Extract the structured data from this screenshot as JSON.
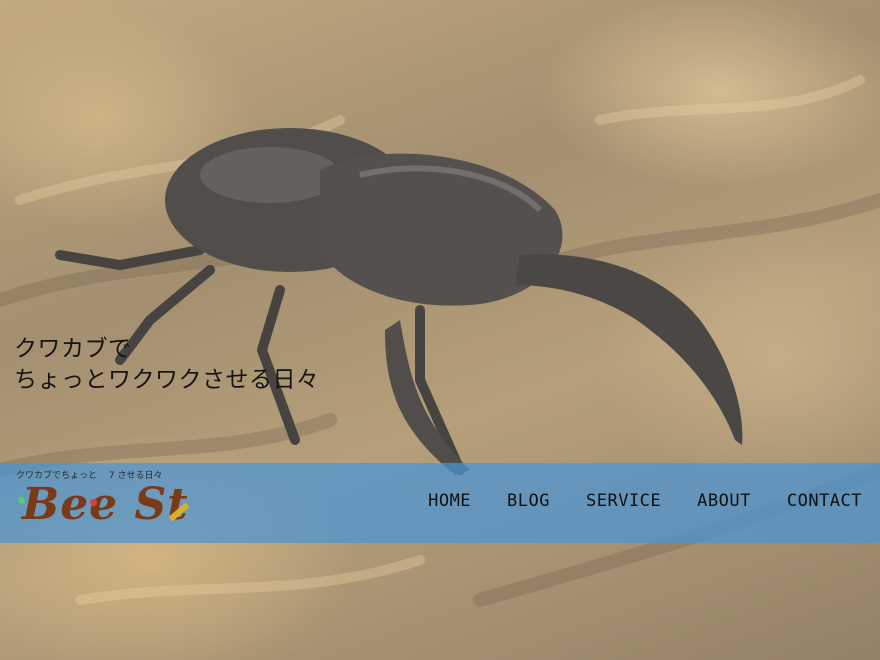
{
  "hero": {
    "image_label": "stag beetle on wood",
    "tagline_line1": "クワカブで",
    "tagline_line2": "ちょっとワクワクさせる日々"
  },
  "logo": {
    "subtitle": "クワカブでちょっと 　7 させる日々",
    "wordmark": "Bee St"
  },
  "nav": {
    "items": [
      "HOME",
      "BLOG",
      "SERVICE",
      "ABOUT",
      "CONTACT"
    ]
  },
  "colors": {
    "navbar_bg": "#4a94d6",
    "logo_brown": "#7a3a18",
    "text_dark": "#141414"
  }
}
